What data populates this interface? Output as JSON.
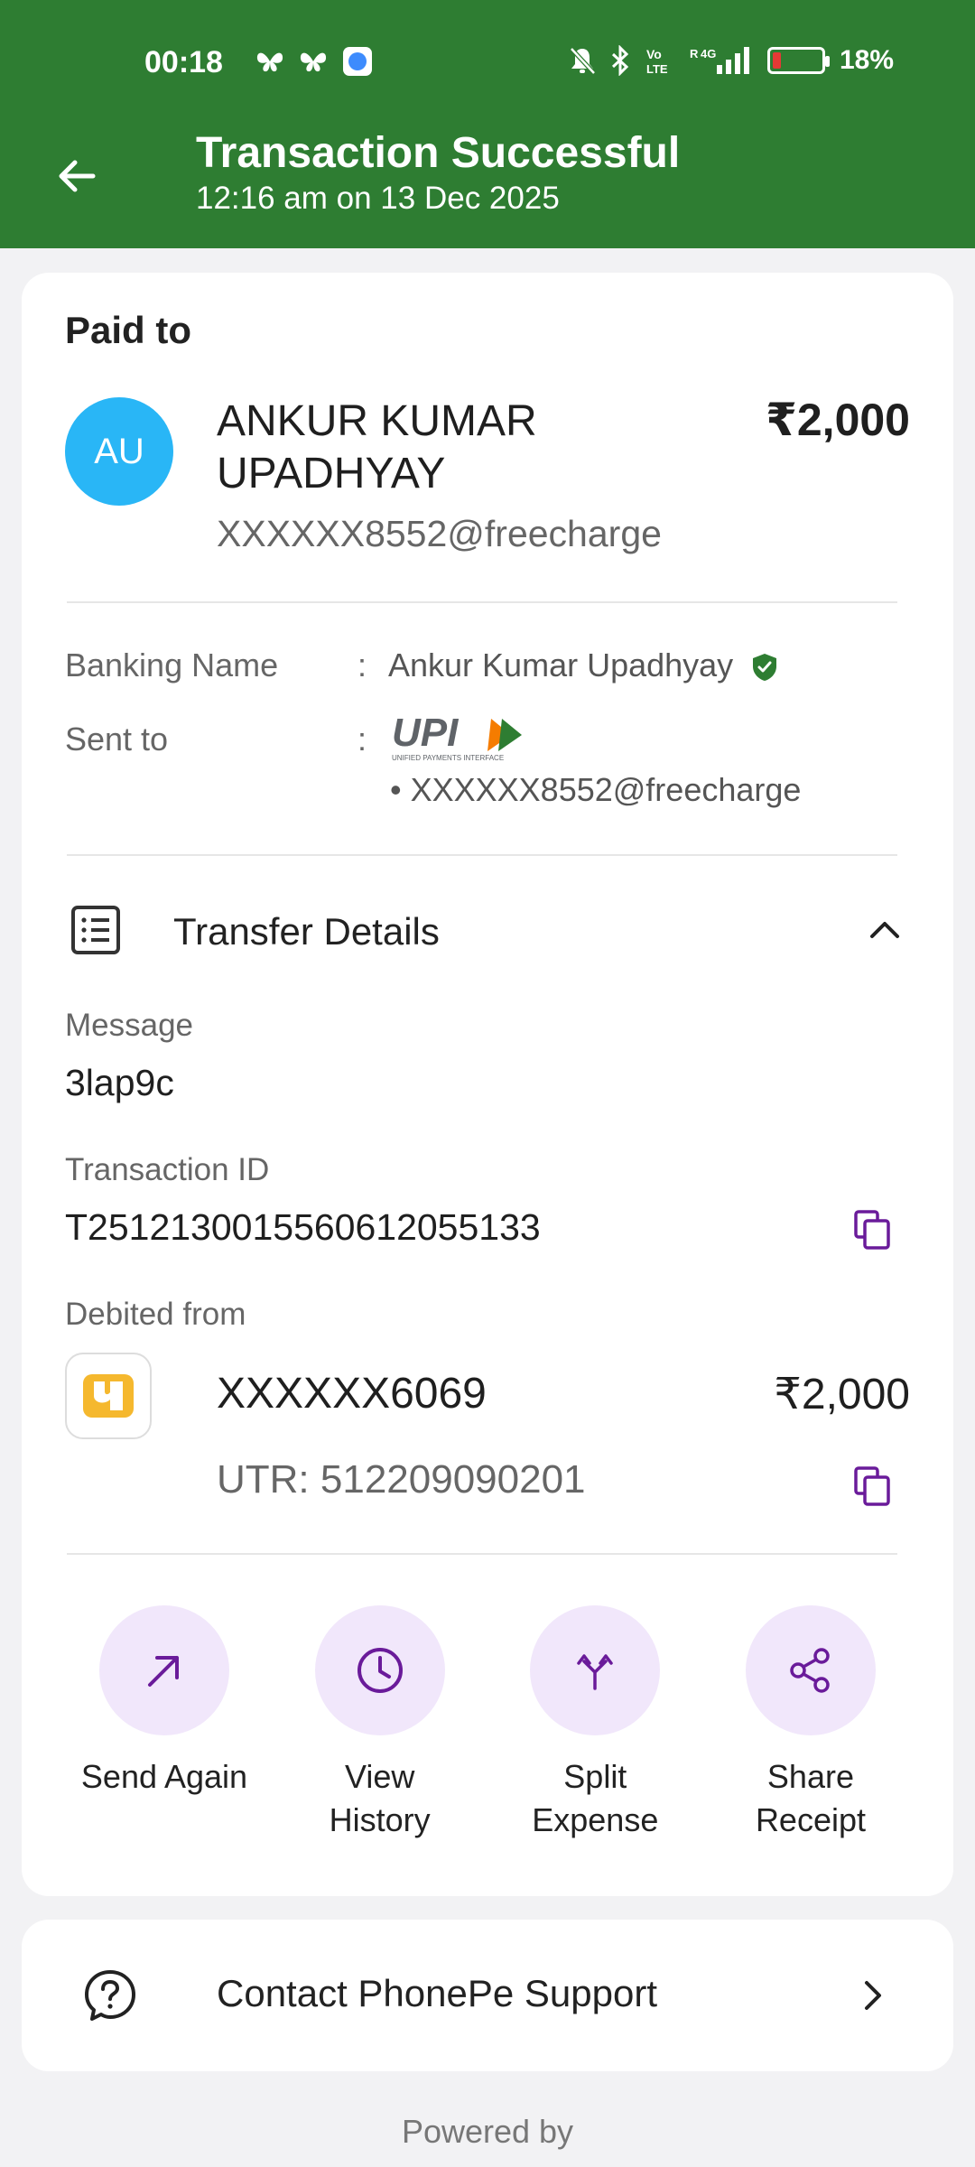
{
  "status_bar": {
    "time": "00:18",
    "battery": "18%",
    "battery_level": 0.18
  },
  "header": {
    "title": "Transaction Successful",
    "subtitle": "12:16 am on 13 Dec 2025"
  },
  "payee": {
    "section_label": "Paid to",
    "avatar_initials": "AU",
    "name": "ANKUR KUMAR UPADHYAY",
    "amount": "₹2,000",
    "upi_id": "XXXXXX8552@freecharge"
  },
  "details": {
    "banking_name_label": "Banking Name",
    "banking_name_value": "Ankur Kumar Upadhyay",
    "sent_to_label": "Sent to",
    "colon": ":",
    "upi_logo_text": "UPI",
    "upi_logo_sub": "UNIFIED PAYMENTS INTERFACE",
    "sent_to_value": "• XXXXXX8552@freecharge"
  },
  "transfer": {
    "title": "Transfer Details",
    "message_label": "Message",
    "message_value": "3lap9c",
    "txn_label": "Transaction ID",
    "txn_value": "T2512130015560612055133",
    "debited_label": "Debited from",
    "account": "XXXXXX6069",
    "account_amount": "₹2,000",
    "utr": "UTR: 512209090201"
  },
  "actions": [
    {
      "label": "Send Again",
      "icon": "arrow-up-right-icon"
    },
    {
      "label": "View\nHistory",
      "icon": "clock-icon"
    },
    {
      "label": "Split\nExpense",
      "icon": "split-icon"
    },
    {
      "label": "Share\nReceipt",
      "icon": "share-icon"
    }
  ],
  "support": {
    "label": "Contact PhonePe Support"
  },
  "footer": {
    "powered_by": "Powered by"
  },
  "colors": {
    "header_green": "#2e7d32",
    "accent_purple": "#6a1b9a",
    "action_bg": "#f1e7fb",
    "avatar_blue": "#29b6f6"
  }
}
